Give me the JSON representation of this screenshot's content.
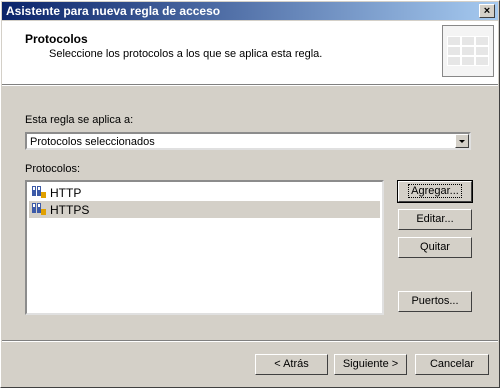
{
  "window": {
    "title": "Asistente para nueva regla de acceso",
    "close_glyph": "×"
  },
  "header": {
    "title": "Protocolos",
    "subtitle": "Seleccione los protocolos a los que se aplica esta regla."
  },
  "applies_to": {
    "label": "Esta regla se aplica a:",
    "selected": "Protocolos seleccionados"
  },
  "protocols": {
    "label": "Protocolos:",
    "items": [
      {
        "name": "HTTP",
        "icon": "protocol-icon",
        "selected": false
      },
      {
        "name": "HTTPS",
        "icon": "protocol-icon",
        "selected": true
      }
    ]
  },
  "side_buttons": {
    "add": "Agregar...",
    "edit": "Editar...",
    "remove": "Quitar",
    "ports": "Puertos..."
  },
  "footer": {
    "back": "< Atrás",
    "next": "Siguiente >",
    "cancel": "Cancelar"
  }
}
